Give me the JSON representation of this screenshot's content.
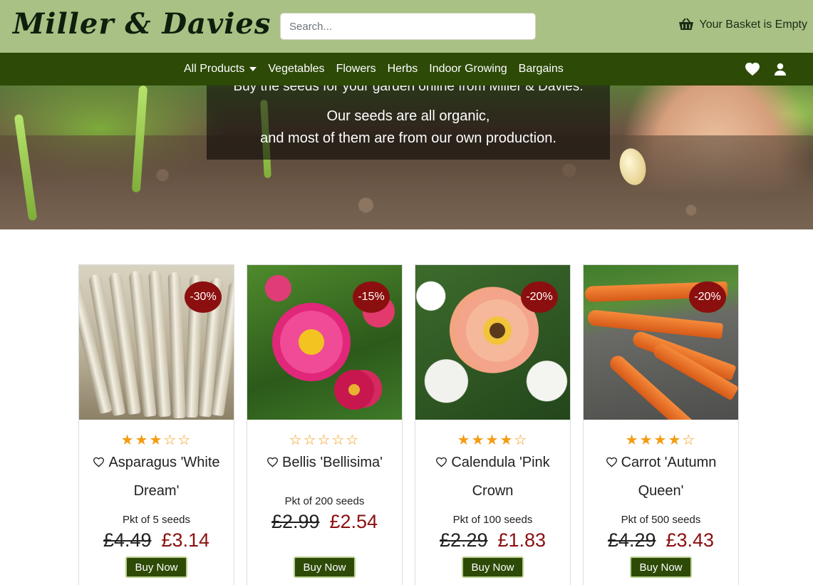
{
  "header": {
    "logo": "Miller & Davies",
    "search_placeholder": "Search...",
    "basket_label": "Your Basket is Empty"
  },
  "nav": {
    "items": [
      {
        "label": "All Products",
        "dropdown": true
      },
      {
        "label": "Vegetables"
      },
      {
        "label": "Flowers"
      },
      {
        "label": "Herbs"
      },
      {
        "label": "Indoor Growing"
      },
      {
        "label": "Bargains"
      }
    ],
    "icons": [
      "heart-icon",
      "user-icon"
    ]
  },
  "hero": {
    "line1": "Buy the seeds for your garden online from Miller & Davies.",
    "line2": "Our seeds are all organic,",
    "line3": "and most of them are from our own production."
  },
  "products": [
    {
      "name": "Asparagus 'White Dream'",
      "badge": "-30%",
      "rating": 3,
      "max_rating": 5,
      "pack": "Pkt of 5 seeds",
      "old_price": "£4.49",
      "new_price": "£3.14",
      "button": "Buy Now"
    },
    {
      "name": "Bellis 'Bellisima'",
      "badge": "-15%",
      "rating": 0,
      "max_rating": 5,
      "pack": "Pkt of 200 seeds",
      "old_price": "£2.99",
      "new_price": "£2.54",
      "button": "Buy Now"
    },
    {
      "name": "Calendula 'Pink Crown",
      "badge": "-20%",
      "rating": 4,
      "max_rating": 5,
      "pack": "Pkt of 100 seeds",
      "old_price": "£2.29",
      "new_price": "£1.83",
      "button": "Buy Now"
    },
    {
      "name": "Carrot 'Autumn Queen'",
      "badge": "-20%",
      "rating": 4,
      "max_rating": 5,
      "pack": "Pkt of 500 seeds",
      "old_price": "£4.29",
      "new_price": "£3.43",
      "button": "Buy Now"
    }
  ],
  "colors": {
    "header_bg": "#a9c184",
    "nav_bg": "#2d4a07",
    "sale_red": "#8b0f0f",
    "star": "#f39c12"
  }
}
